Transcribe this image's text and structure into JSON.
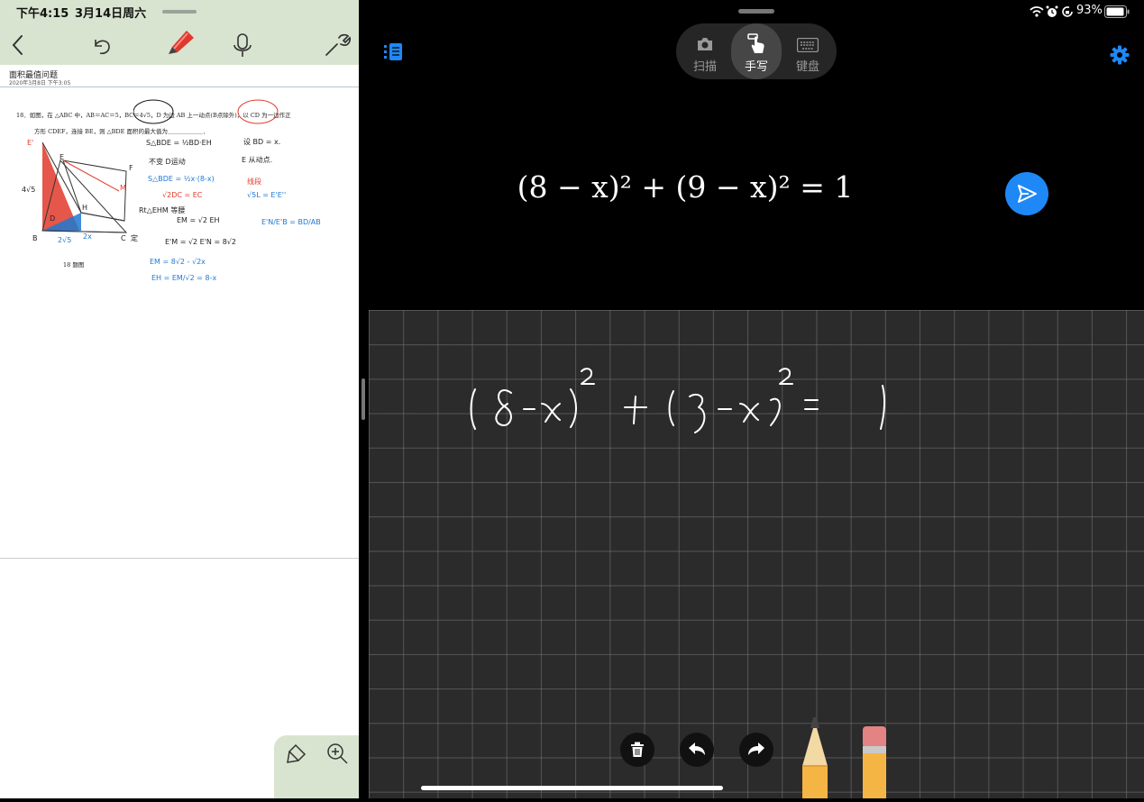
{
  "left_pane": {
    "status": {
      "time": "下午4:15",
      "date": "3月14日周六"
    },
    "toolbar": {
      "back_icon": "chevron-left-icon",
      "undo_icon": "undo-icon",
      "highlighter_icon": "marker-icon",
      "mic_icon": "microphone-icon",
      "settings_icon": "wrench-icon"
    },
    "document": {
      "title": "面积最值问题",
      "date": "2020年3月8日 下午3:05",
      "question_line1": "18．如图，在 △ABC 中，AB＝AC＝5，BC＝4√5，D 为边 AB 上一动点(B点除外)，以 CD 为一边作正",
      "question_line2": "方形 CDEF，连接 BE，则 △BDE 面积的最大值为＿＿＿＿＿＿．",
      "figure_caption": "18 题图",
      "figure_labels": {
        "E1": "E'",
        "E": "E",
        "F": "F",
        "B": "B",
        "D": "D",
        "C": "C",
        "M": "M",
        "H": "H",
        "side": "4√5",
        "ding": "定",
        "bottom_left": "2√5",
        "bottom_right": "2x"
      },
      "notes": [
        {
          "text": "S△BDE = ½BD·EH",
          "color": "#222"
        },
        {
          "text": "设 BD = x.",
          "color": "#222"
        },
        {
          "text": "不变      D运动",
          "color": "#222"
        },
        {
          "text": "E 从动点.",
          "color": "#222"
        },
        {
          "text": "S△BDE = ½x·(8-x)",
          "color": "#1f78d1"
        },
        {
          "text": "√2DC = EC",
          "color": "#e03a2c"
        },
        {
          "text": "线段",
          "color": "#e03a2c"
        },
        {
          "text": "Rt△EHM 等腰",
          "color": "#222"
        },
        {
          "text": "EM = √2 EH",
          "color": "#222"
        },
        {
          "text": "√5L = E'E''",
          "color": "#1f78d1"
        },
        {
          "text": "E'N/E'B = BD/AB",
          "color": "#1f78d1"
        },
        {
          "text": "E'M = √2 E'N = 8√2",
          "color": "#222"
        },
        {
          "text": "EM = 8√2 - √2x",
          "color": "#1f78d1"
        },
        {
          "text": "EH = EM/√2 = 8-x",
          "color": "#1f78d1"
        }
      ]
    },
    "bottom_tools": {
      "lasso_icon": "lasso-icon",
      "zoom_icon": "zoom-in-icon"
    }
  },
  "right_pane": {
    "status": {
      "battery": "93%",
      "icons": [
        "wifi-icon",
        "alarm-icon",
        "rotation-lock-icon",
        "battery-icon"
      ]
    },
    "sidebar_icon": "list-icon",
    "modes": [
      {
        "label": "扫描",
        "icon": "camera-icon",
        "active": false
      },
      {
        "label": "手写",
        "icon": "hand-pointer-icon",
        "active": true
      },
      {
        "label": "键盘",
        "icon": "keyboard-icon",
        "active": false
      }
    ],
    "settings_icon": "gear-icon",
    "equation": "(8 − x)² + (9 − x)² = 1",
    "send_icon": "send-icon",
    "canvas_tools": [
      "trash-icon",
      "undo-icon",
      "redo-icon",
      "pencil-icon",
      "eraser-icon"
    ]
  }
}
